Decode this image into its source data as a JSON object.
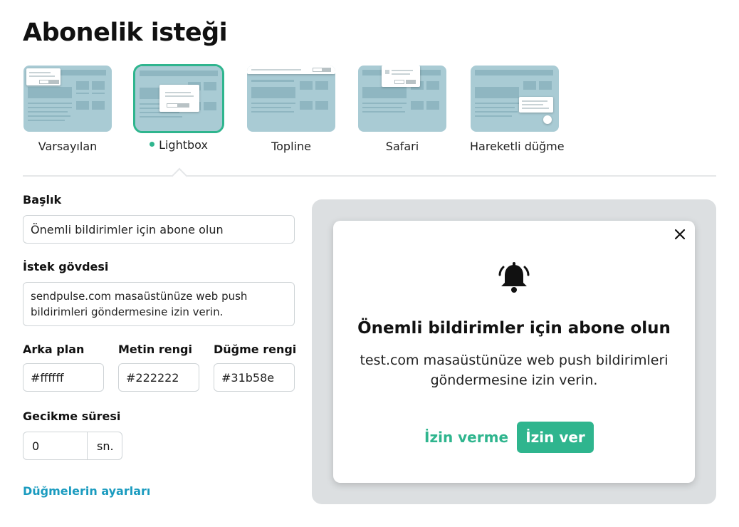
{
  "page_title": "Abonelik isteği",
  "layouts": [
    {
      "label": "Varsayılan",
      "selected": false
    },
    {
      "label": "Lightbox",
      "selected": true
    },
    {
      "label": "Topline",
      "selected": false
    },
    {
      "label": "Safari",
      "selected": false
    },
    {
      "label": "Hareketli düğme",
      "selected": false
    }
  ],
  "form": {
    "title_label": "Başlık",
    "title_value": "Önemli bildirimler için abone olun",
    "body_label": "İstek gövdesi",
    "body_value": "sendpulse.com masaüstünüze web push bildirimleri göndermesine izin verin.",
    "background_label": "Arka plan",
    "background_value": "#ffffff",
    "text_color_label": "Metin rengi",
    "text_color_value": "#222222",
    "button_color_label": "Düğme rengi",
    "button_color_value": "#31b58e",
    "delay_label": "Gecikme süresi",
    "delay_value": "0",
    "delay_unit": "sn.",
    "button_settings_link": "Düğmelerin ayarları"
  },
  "preview": {
    "close_icon": "close-icon",
    "bell_icon": "bell-icon",
    "title": "Önemli bildirimler için abone olun",
    "body": "test.com masaüstünüze web push bildirimleri göndermesine izin verin.",
    "deny_label": "İzin verme",
    "allow_label": "İzin ver"
  },
  "colors": {
    "accent": "#2fb58e",
    "link": "#1a9bbf",
    "thumb_bg": "#a9cbd4",
    "preview_bg": "#dcdfe1"
  }
}
